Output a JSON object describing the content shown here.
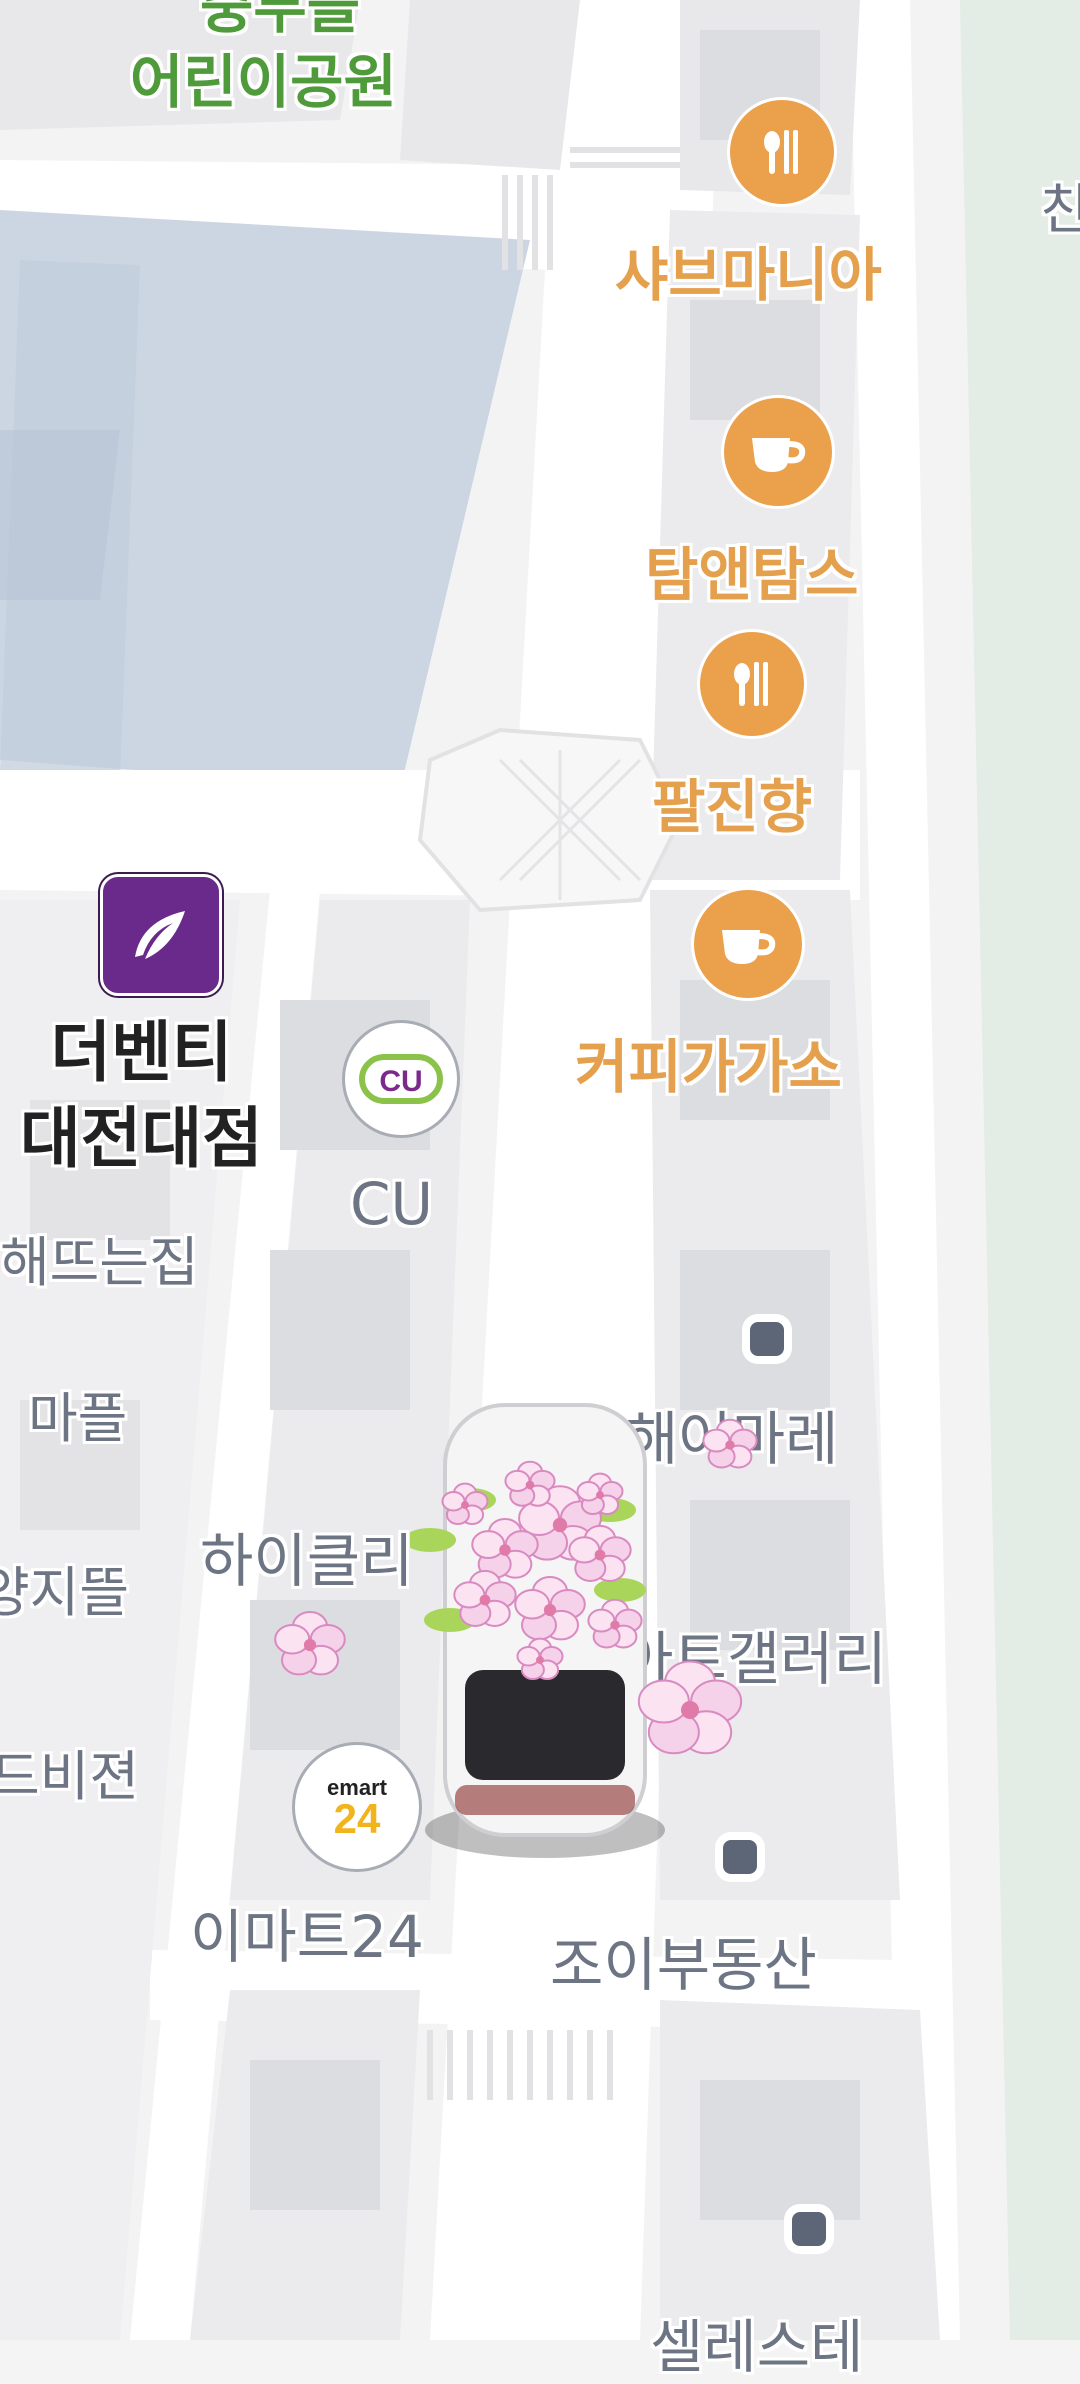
{
  "park": {
    "line1": "중부블",
    "line2": "어린이공원"
  },
  "restaurants": [
    {
      "name": "샤브마니아",
      "icon": "restaurant-icon"
    },
    {
      "name": "탐앤탐스",
      "icon": "cafe-icon"
    },
    {
      "name": "팔진향",
      "icon": "restaurant-icon"
    },
    {
      "name": "커피가가소",
      "icon": "cafe-icon"
    }
  ],
  "department_store": {
    "line1": "더벤티",
    "line2": "대전대점",
    "icon": "theventi-logo"
  },
  "convenience": [
    {
      "name": "CU",
      "logo_text": "CU",
      "icon": "cu-logo"
    },
    {
      "name": "이마트24",
      "logo_text_top": "emart",
      "logo_text_bottom": "24",
      "icon": "emart24-logo"
    }
  ],
  "places": {
    "haeddeun": "해뜨는집",
    "mapeul": "마플",
    "yangji": "양지뜰",
    "dvision": "드비젼",
    "hyclear": "하이클리",
    "haeeon": "해어마레",
    "art_gallery": "아트갤러리",
    "joy_realty": "조이부동산",
    "celeste": "셀레스테",
    "edge_char": "친"
  },
  "current_location": {
    "icon": "car-with-cherry-blossoms-icon"
  },
  "colors": {
    "road": "#ffffff",
    "block": "#ebebed",
    "building": "#dcdde1",
    "campus": "#cdd6e3",
    "food_accent": "#eba04c",
    "park_text": "#4f9a3a",
    "dept_purple": "#6a2a8c"
  }
}
